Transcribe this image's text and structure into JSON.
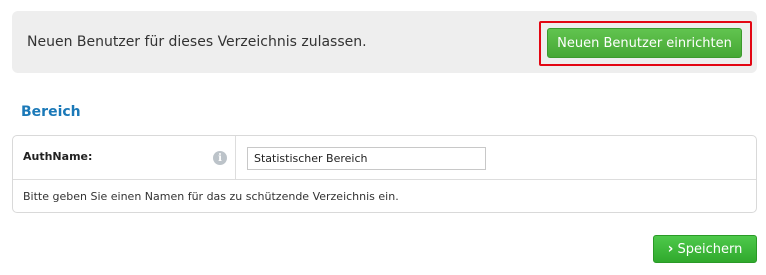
{
  "banner": {
    "text": "Neuen Benutzer für dieses Verzeichnis zulassen.",
    "button_label": "Neuen Benutzer einrichten"
  },
  "section": {
    "title": "Bereich"
  },
  "form": {
    "field_label": "AuthName:",
    "info_icon": "info-icon",
    "input_value": "Statistischer Bereich",
    "hint": "Bitte geben Sie einen Namen für das zu schützende Verzeichnis ein."
  },
  "actions": {
    "save_icon": "chevron-right-icon",
    "save_label": "Speichern"
  },
  "colors": {
    "accent_green": "#46a835",
    "section_title_blue": "#1b79b8",
    "highlight_red": "#e30613"
  }
}
